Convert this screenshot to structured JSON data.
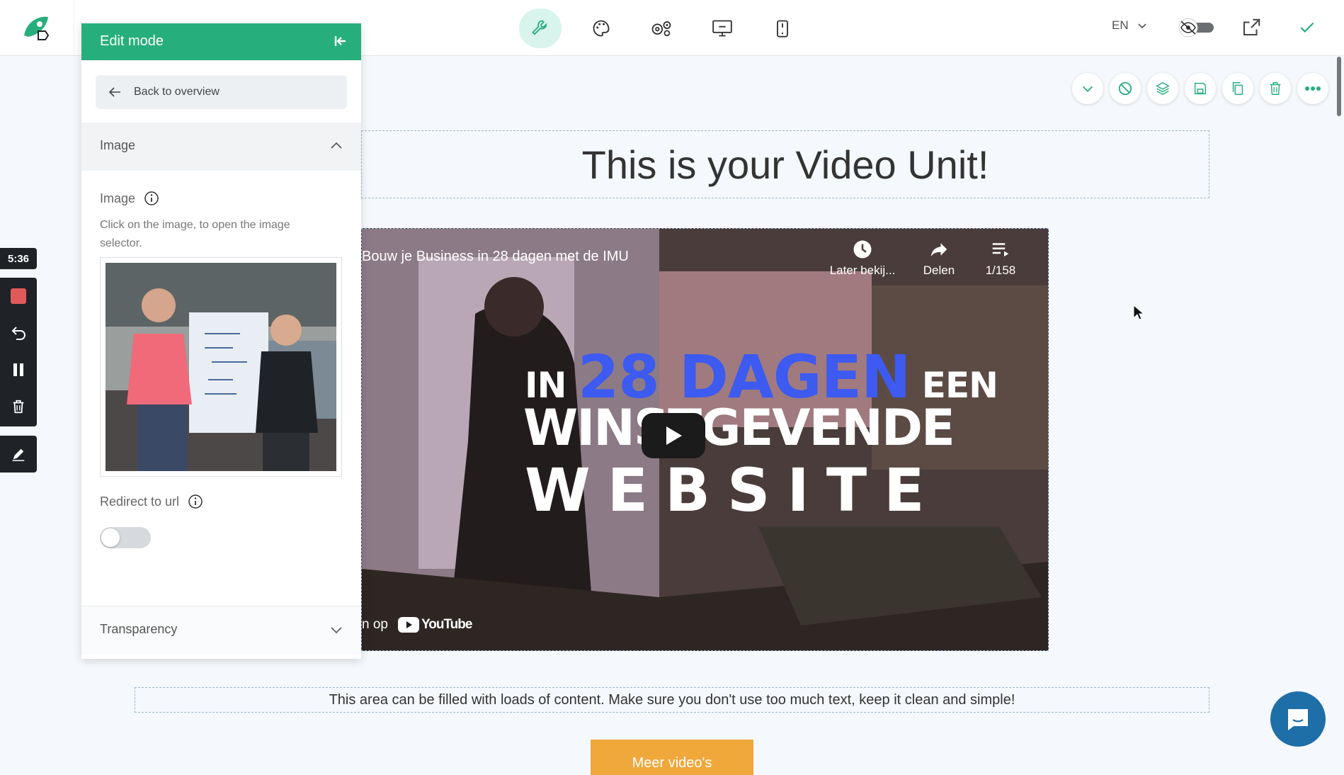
{
  "topbar": {
    "language": "EN",
    "tools": [
      "wrench-icon",
      "palette-icon",
      "settings-icon",
      "desktop-preview-icon",
      "mobile-preview-icon"
    ]
  },
  "panel": {
    "title": "Edit mode",
    "back_label": "Back to overview",
    "section_image": "Image",
    "image_label": "Image",
    "image_help": "Click on the image, to open the image selector.",
    "redirect_label": "Redirect to url",
    "redirect_enabled": false,
    "section_transparency": "Transparency"
  },
  "recorder": {
    "time": "5:36"
  },
  "content": {
    "title": "This is your Video Unit!",
    "video": {
      "title": "Bouw je Business in 28 dagen met de IMU",
      "watch_later": "Later bekij...",
      "share": "Delen",
      "playlist_count": "1/158",
      "overlay_line1_a": "IN ",
      "overlay_line1_b": "28 DAGEN",
      "overlay_line1_c": " EEN",
      "overlay_line2": "WINSTGEVENDE",
      "overlay_line3": "WEBSITE",
      "watch_on_prefix": "n op",
      "youtube": "YouTube"
    },
    "paragraph": "This area can be filled with loads of content. Make sure you don't use too much text, keep it clean and simple!",
    "more_button": "Meer video's"
  },
  "colors": {
    "accent": "#27ae7d",
    "dagen_blue": "#3d5af1",
    "chat_blue": "#1e6ea8",
    "button_orange": "#f0a83a"
  }
}
